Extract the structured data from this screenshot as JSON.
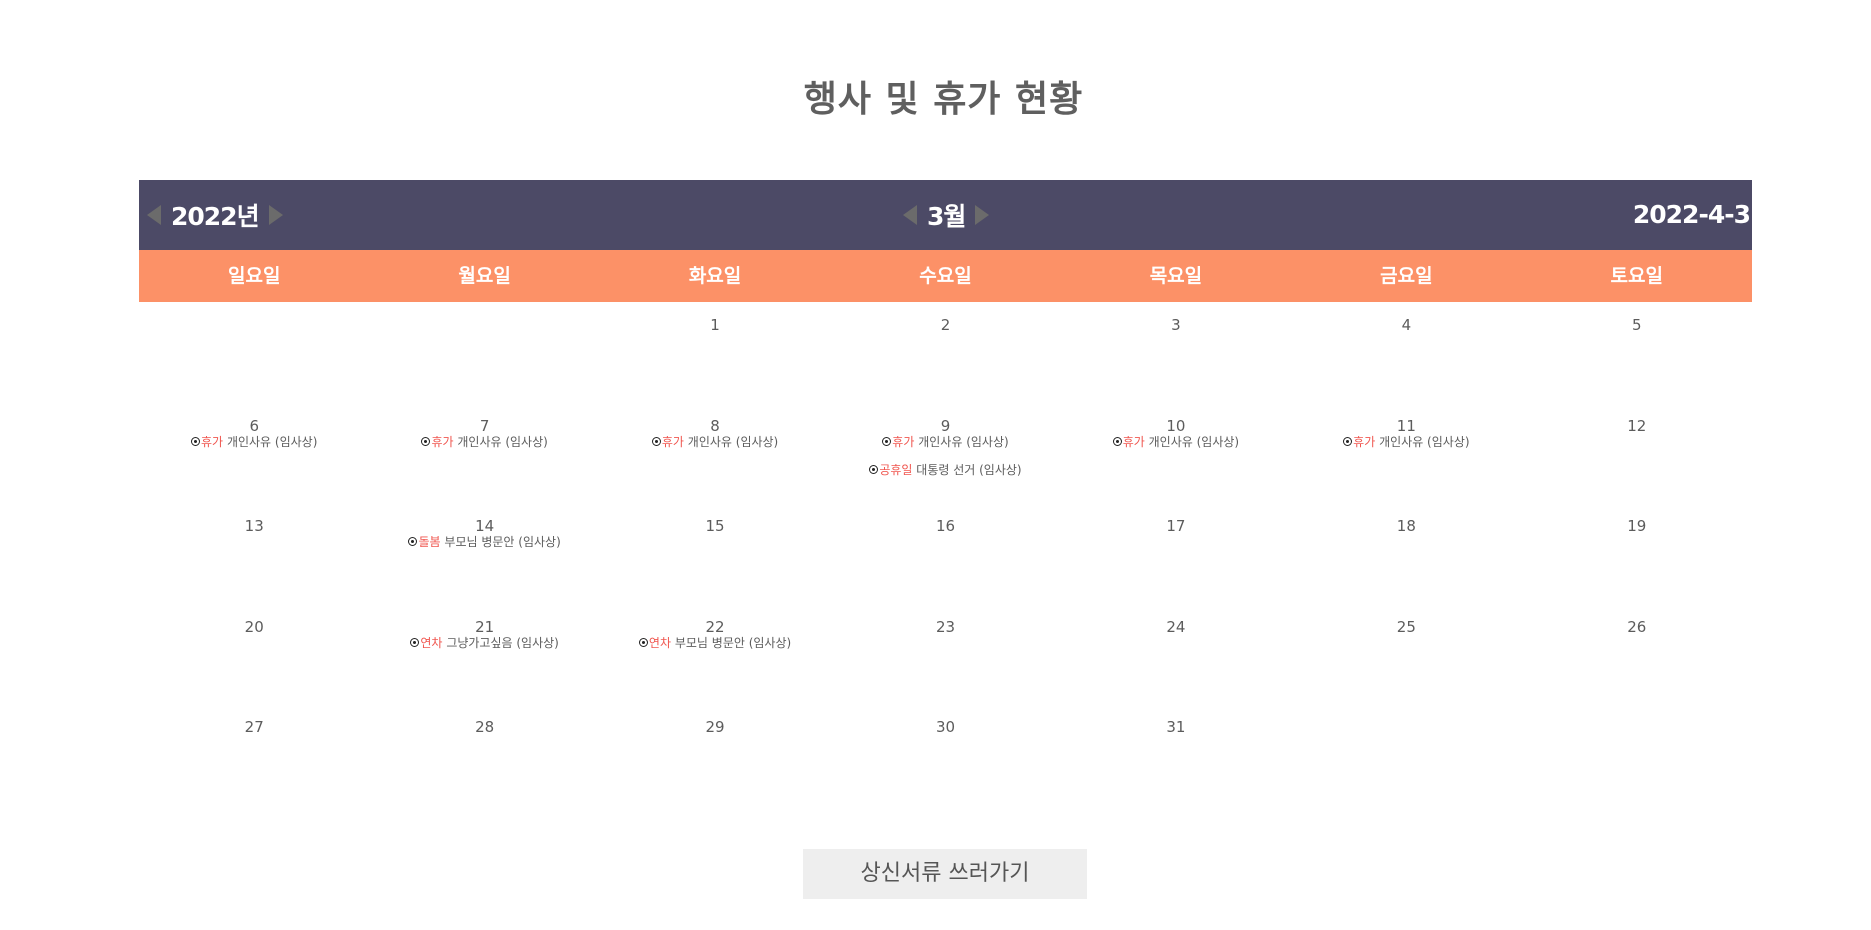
{
  "page_title": "행사 및 휴가 현황",
  "calendar": {
    "year_label": "2022년",
    "month_label": "3월",
    "today_label": "2022-4-3",
    "header_bg": "#4c4a66",
    "weekday_bg": "#fc9167",
    "event_type_color": "#f0564f",
    "weekdays": [
      "일요일",
      "월요일",
      "화요일",
      "수요일",
      "목요일",
      "금요일",
      "토요일"
    ],
    "leading_blank_days": 2,
    "days": [
      {
        "day": "1",
        "events": []
      },
      {
        "day": "2",
        "events": []
      },
      {
        "day": "3",
        "events": []
      },
      {
        "day": "4",
        "events": []
      },
      {
        "day": "5",
        "events": []
      },
      {
        "day": "6",
        "events": [
          {
            "type": "휴가",
            "text": "개인사유 (임사상)"
          }
        ]
      },
      {
        "day": "7",
        "events": [
          {
            "type": "휴가",
            "text": "개인사유 (임사상)"
          }
        ]
      },
      {
        "day": "8",
        "events": [
          {
            "type": "휴가",
            "text": "개인사유 (임사상)"
          }
        ]
      },
      {
        "day": "9",
        "events": [
          {
            "type": "휴가",
            "text": "개인사유 (임사상)"
          },
          {
            "type": "공휴일",
            "text": "대통령 선거 (임사상)"
          }
        ]
      },
      {
        "day": "10",
        "events": [
          {
            "type": "휴가",
            "text": "개인사유 (임사상)"
          }
        ]
      },
      {
        "day": "11",
        "events": [
          {
            "type": "휴가",
            "text": "개인사유 (임사상)"
          }
        ]
      },
      {
        "day": "12",
        "events": []
      },
      {
        "day": "13",
        "events": []
      },
      {
        "day": "14",
        "events": [
          {
            "type": "돌봄",
            "text": "부모님 병문안 (임사상)"
          }
        ]
      },
      {
        "day": "15",
        "events": []
      },
      {
        "day": "16",
        "events": []
      },
      {
        "day": "17",
        "events": []
      },
      {
        "day": "18",
        "events": []
      },
      {
        "day": "19",
        "events": []
      },
      {
        "day": "20",
        "events": []
      },
      {
        "day": "21",
        "events": [
          {
            "type": "연차",
            "text": "그냥가고싶음 (임사상)"
          }
        ]
      },
      {
        "day": "22",
        "events": [
          {
            "type": "연차",
            "text": "부모님 병문안 (임사상)"
          }
        ]
      },
      {
        "day": "23",
        "events": []
      },
      {
        "day": "24",
        "events": []
      },
      {
        "day": "25",
        "events": []
      },
      {
        "day": "26",
        "events": []
      },
      {
        "day": "27",
        "events": []
      },
      {
        "day": "28",
        "events": []
      },
      {
        "day": "29",
        "events": []
      },
      {
        "day": "30",
        "events": []
      },
      {
        "day": "31",
        "events": []
      }
    ]
  },
  "submit_button_label": "상신서류 쓰러가기"
}
